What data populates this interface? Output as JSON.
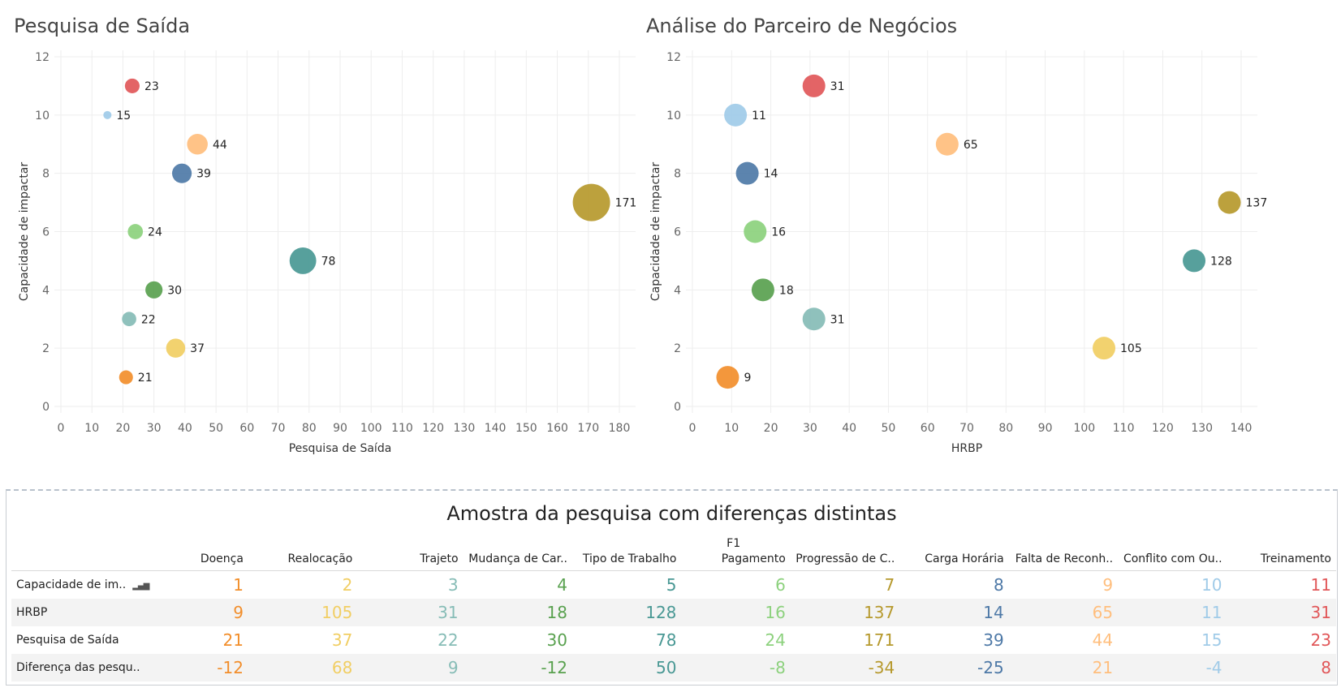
{
  "colors": {
    "Doença": "#f28e2b",
    "Realocação": "#f1ce63",
    "Trajeto": "#86bcb6",
    "Mudança de Car..": "#59a14f",
    "Tipo de Trabalho": "#499894",
    "Pagamento": "#8cd17d",
    "Progressão de C..": "#b6992d",
    "Carga Horária": "#4e79a7",
    "Falta de Reconh..": "#ffbe7d",
    "Conflito com Ou..": "#a0cbe8",
    "Treinamento": "#e15759"
  },
  "chart_data": [
    {
      "type": "scatter",
      "title": "Pesquisa de Saída",
      "xlabel": "Pesquisa de Saída",
      "ylabel": "Capacidade de impactar",
      "xlim": [
        0,
        180
      ],
      "ylim": [
        0,
        12
      ],
      "xticks": [
        0,
        10,
        20,
        30,
        40,
        50,
        60,
        70,
        80,
        90,
        100,
        110,
        120,
        130,
        140,
        150,
        160,
        170,
        180
      ],
      "yticks": [
        0,
        2,
        4,
        6,
        8,
        10,
        12
      ],
      "points": [
        {
          "category": "Treinamento",
          "x": 23,
          "y": 11,
          "label": "23"
        },
        {
          "category": "Conflito com Ou..",
          "x": 15,
          "y": 10,
          "label": "15"
        },
        {
          "category": "Falta de Reconh..",
          "x": 44,
          "y": 9,
          "label": "44"
        },
        {
          "category": "Carga Horária",
          "x": 39,
          "y": 8,
          "label": "39"
        },
        {
          "category": "Progressão de C..",
          "x": 171,
          "y": 7,
          "label": "171"
        },
        {
          "category": "Pagamento",
          "x": 24,
          "y": 6,
          "label": "24"
        },
        {
          "category": "Tipo de Trabalho",
          "x": 78,
          "y": 5,
          "label": "78"
        },
        {
          "category": "Mudança de Car..",
          "x": 30,
          "y": 4,
          "label": "30"
        },
        {
          "category": "Trajeto",
          "x": 22,
          "y": 3,
          "label": "22"
        },
        {
          "category": "Realocação",
          "x": 37,
          "y": 2,
          "label": "37"
        },
        {
          "category": "Doença",
          "x": 21,
          "y": 1,
          "label": "21"
        }
      ]
    },
    {
      "type": "scatter",
      "title": "Análise do Parceiro de Negócios",
      "xlabel": "HRBP",
      "ylabel": "Capacidade de impactar",
      "xlim": [
        0,
        140
      ],
      "ylim": [
        0,
        12
      ],
      "xticks": [
        0,
        10,
        20,
        30,
        40,
        50,
        60,
        70,
        80,
        90,
        100,
        110,
        120,
        130,
        140
      ],
      "yticks": [
        0,
        2,
        4,
        6,
        8,
        10,
        12
      ],
      "points": [
        {
          "category": "Treinamento",
          "x": 31,
          "y": 11,
          "label": "31"
        },
        {
          "category": "Conflito com Ou..",
          "x": 11,
          "y": 10,
          "label": "11"
        },
        {
          "category": "Falta de Reconh..",
          "x": 65,
          "y": 9,
          "label": "65"
        },
        {
          "category": "Carga Horária",
          "x": 14,
          "y": 8,
          "label": "14"
        },
        {
          "category": "Progressão de C..",
          "x": 137,
          "y": 7,
          "label": "137"
        },
        {
          "category": "Pagamento",
          "x": 16,
          "y": 6,
          "label": "16"
        },
        {
          "category": "Tipo de Trabalho",
          "x": 128,
          "y": 5,
          "label": "128"
        },
        {
          "category": "Mudança de Car..",
          "x": 18,
          "y": 4,
          "label": "18"
        },
        {
          "category": "Trajeto",
          "x": 31,
          "y": 3,
          "label": "31"
        },
        {
          "category": "Realocação",
          "x": 105,
          "y": 2,
          "label": "105"
        },
        {
          "category": "Doença",
          "x": 9,
          "y": 1,
          "label": "9"
        }
      ]
    },
    {
      "type": "table",
      "title": "Amostra da pesquisa com diferenças distintas",
      "header_group": "F1",
      "columns": [
        "Doença",
        "Realocação",
        "Trajeto",
        "Mudança de Car..",
        "Tipo de Trabalho",
        "Pagamento",
        "Progressão de C..",
        "Carga Horária",
        "Falta de Reconh..",
        "Conflito com Ou..",
        "Treinamento"
      ],
      "rows": [
        {
          "label": "Capacidade de im..",
          "values": [
            1,
            2,
            3,
            4,
            5,
            6,
            7,
            8,
            9,
            10,
            11
          ]
        },
        {
          "label": "HRBP",
          "values": [
            9,
            105,
            31,
            18,
            128,
            16,
            137,
            14,
            65,
            11,
            31
          ]
        },
        {
          "label": "Pesquisa de Saída",
          "values": [
            21,
            37,
            22,
            30,
            78,
            24,
            171,
            39,
            44,
            15,
            23
          ]
        },
        {
          "label": "Diferença das pesqu..",
          "values": [
            -12,
            68,
            9,
            -12,
            50,
            -8,
            -34,
            -25,
            21,
            -4,
            8
          ]
        }
      ]
    }
  ]
}
